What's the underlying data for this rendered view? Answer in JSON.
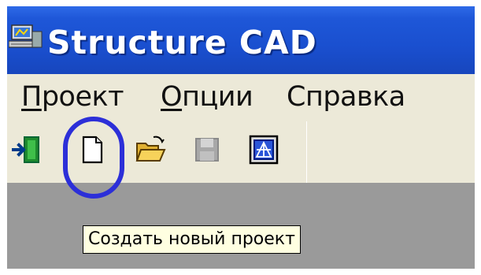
{
  "window": {
    "title": "Structure CAD"
  },
  "menu": {
    "items": [
      {
        "accel": "П",
        "rest": "роект"
      },
      {
        "accel": "О",
        "rest": "пции"
      },
      {
        "accel": "",
        "rest": "Справка"
      }
    ]
  },
  "toolbar": {
    "buttons": [
      {
        "icon": "exit-icon",
        "enabled": true
      },
      {
        "icon": "new-document-icon",
        "enabled": true
      },
      {
        "icon": "open-folder-icon",
        "enabled": true
      },
      {
        "icon": "save-floppy-icon",
        "enabled": false
      },
      {
        "icon": "structure-view-icon",
        "enabled": true
      }
    ]
  },
  "tooltip": {
    "text": "Создать новый проект"
  },
  "colors": {
    "titlebar": "#1a4fcf",
    "menubar": "#ece9d8",
    "workspace": "#9a9a9a",
    "highlight": "#2c2fd8",
    "tooltip_bg": "#ffffe1"
  }
}
